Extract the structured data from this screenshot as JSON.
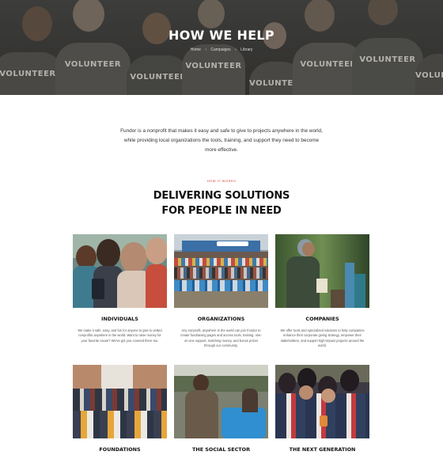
{
  "hero": {
    "title": "HOW WE HELP",
    "breadcrumb": [
      "Home",
      "Campaigns",
      "Library"
    ],
    "shirt_text": "VOLUNTEER"
  },
  "intro": {
    "text": "Fundor is a nonprofit that makes it easy and safe to give to projects anywhere in the world, while providing local organizations the tools, training, and support they need to become more effective."
  },
  "section": {
    "eyebrow": "HOW IT WORKS",
    "heading_line1": "DELIVERING SOLUTIONS",
    "heading_line2": "FOR PEOPLE IN NEED"
  },
  "cards": [
    {
      "title": "INDIVIDUALS",
      "desc": "We make it safe, easy, and fun for anyone to give to vetted nonprofits anywhere in the world. Want to raise money for your favorite cause? We've got you covered there too."
    },
    {
      "title": "ORGANIZATIONS",
      "desc": "Any nonprofit, anywhere in the world can join Fundor to create fundraising pages and access tools, training, one-on-one support, matching money, and bonus prizes through our community."
    },
    {
      "title": "COMPANIES",
      "desc": "We offer tools and specialized solutions to help companies enhance their corporate giving strategy, empower their stakeholders, and support high-impact projects around the world."
    },
    {
      "title": "FOUNDATIONS",
      "desc": ""
    },
    {
      "title": "THE SOCIAL SECTOR",
      "desc": ""
    },
    {
      "title": "THE NEXT GENERATION",
      "desc": ""
    }
  ],
  "colors": {
    "accent": "#d7372b",
    "heading": "#111111",
    "hero_bg": "#3f3e3b"
  }
}
